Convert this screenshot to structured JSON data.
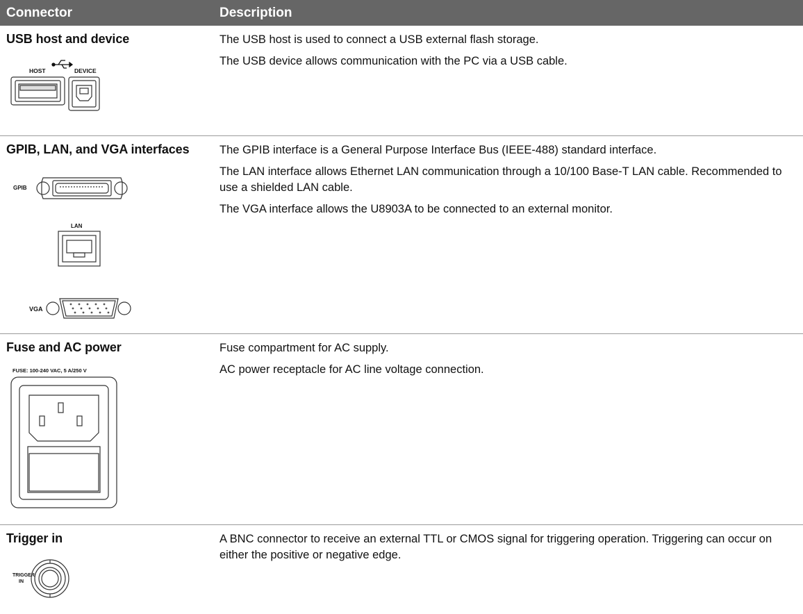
{
  "header": {
    "col_connector": "Connector",
    "col_description": "Description"
  },
  "rows": [
    {
      "name": "USB host and device",
      "desc": [
        "The USB host is used to connect a USB external flash storage.",
        "The USB device allows communication with the PC via a USB cable."
      ],
      "image_labels": {
        "host": "HOST",
        "device": "DEVICE"
      }
    },
    {
      "name": "GPIB, LAN, and VGA interfaces",
      "desc": [
        "The GPIB interface is a General Purpose Interface Bus (IEEE-488) standard interface.",
        "The LAN interface allows Ethernet LAN communication through a 10/100 Base-T LAN cable. Recommended to use a shielded LAN cable.",
        "The VGA interface allows the U8903A to be connected to an external monitor."
      ],
      "image_labels": {
        "gpib": "GPIB",
        "lan": "LAN",
        "vga": "VGA"
      }
    },
    {
      "name": "Fuse and AC power",
      "desc": [
        "Fuse compartment for AC supply.",
        "AC power receptacle for AC line voltage connection."
      ],
      "image_labels": {
        "fuse": "FUSE: 100-240 VAC, 5 A/250 V"
      }
    },
    {
      "name": "Trigger in",
      "desc": [
        "A BNC connector to receive an external TTL or CMOS signal for triggering operation. Triggering can occur on either the positive or negative edge."
      ],
      "image_labels": {
        "trigger_1": "TRIGGER",
        "trigger_2": "IN"
      }
    }
  ]
}
